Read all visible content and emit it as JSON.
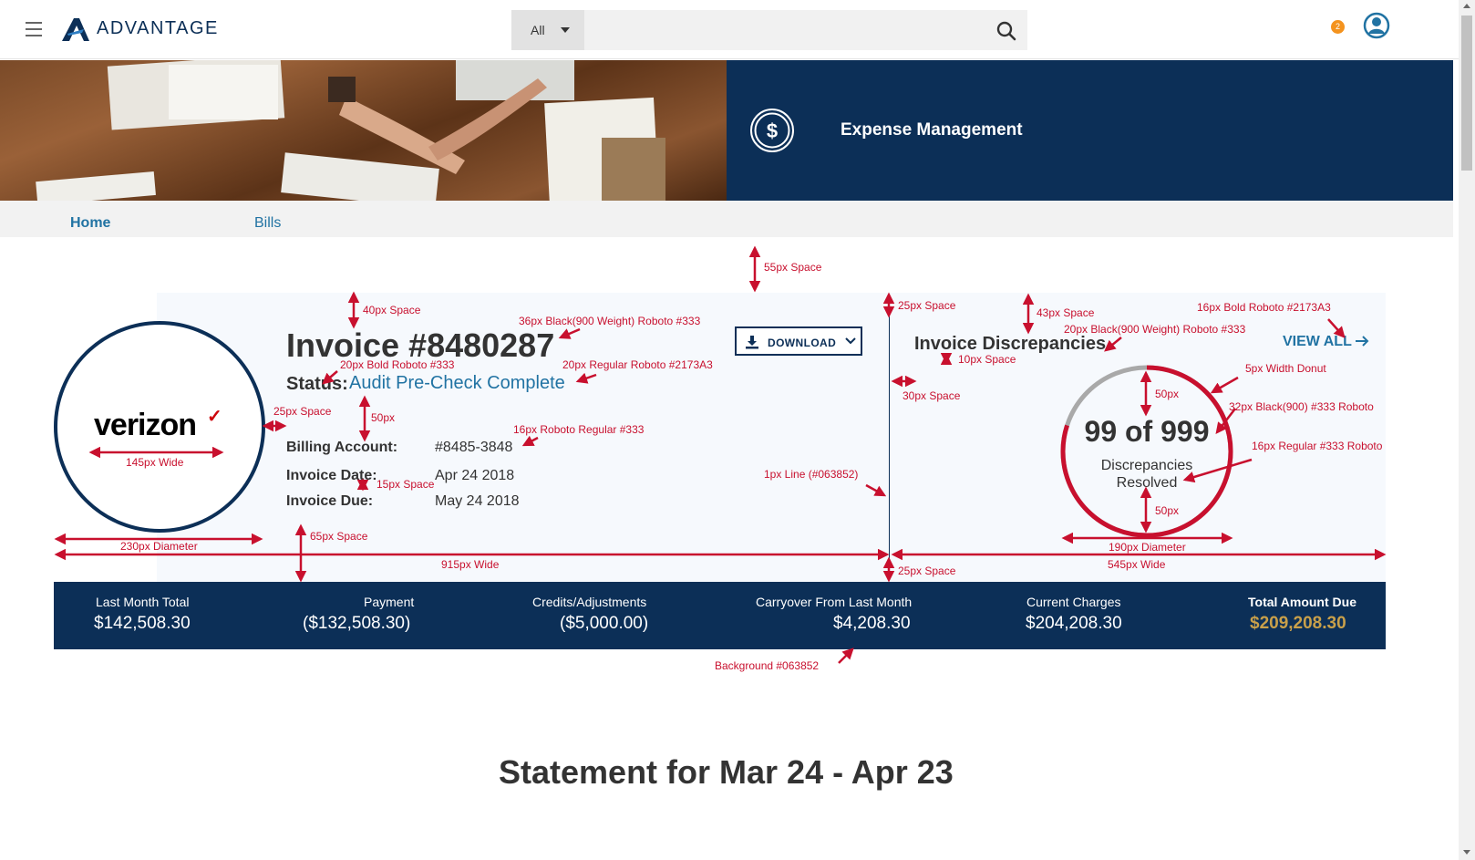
{
  "header": {
    "logo_text": "ADVANTAGE",
    "search_filter": "All",
    "search_placeholder": "",
    "notification_count": "2"
  },
  "banner": {
    "title": "Expense Management"
  },
  "tabs": [
    {
      "label": "Home"
    },
    {
      "label": "Bills"
    }
  ],
  "invoice": {
    "carrier": "verizon",
    "carrier_mark": "✓",
    "title": "Invoice #8480287",
    "status_label": "Status:",
    "status_value": "Audit Pre-Check Complete",
    "fields": [
      {
        "label": "Billing Account:",
        "value": "#8485-3848"
      },
      {
        "label": "Invoice Date:",
        "value": "Apr 24 2018"
      },
      {
        "label": "Invoice Due:",
        "value": "May 24 2018"
      }
    ],
    "download_label": "DOWNLOAD"
  },
  "discrepancies": {
    "title": "Invoice Discrepancies",
    "view_all_label": "VIEW ALL",
    "value": "99 of 999",
    "caption_line1": "Discrepancies",
    "caption_line2": "Resolved",
    "resolved": 99,
    "total": 999
  },
  "totals": [
    {
      "label": "Last Month Total",
      "value": "$142,508.30"
    },
    {
      "label": "Payment",
      "value": "($132,508.30)"
    },
    {
      "label": "Credits/Adjustments",
      "value": "($5,000.00)"
    },
    {
      "label": "Carryover From Last Month",
      "value": "$4,208.30"
    },
    {
      "label": "Current Charges",
      "value": "$204,208.30"
    },
    {
      "label": "Total Amount Due",
      "value": "$209,208.30"
    }
  ],
  "statement_title": "Statement for Mar 24 - Apr 23",
  "annotations": [
    "55px Space",
    "40px Space",
    "36px Black(900 Weight) Roboto #333",
    "20px Bold Roboto #333",
    "20px Regular Roboto #2173A3",
    "25px Space",
    "50px",
    "16px Roboto Regular #333",
    "145px Wide",
    "15px Space",
    "230px Diameter",
    "65px Space",
    "915px Wide",
    "1px Line (#063852)",
    "25px Space",
    "43px Space",
    "16px Bold Roboto #2173A3",
    "20px Black(900 Weight) Roboto #333",
    "10px Space",
    "30px Space",
    "5px Width Donut",
    "50px",
    "32px Black(900) #333 Roboto",
    "16px Regular #333 Roboto",
    "50px",
    "190px Diameter",
    "545px Wide",
    "25px Space",
    "Background #063852"
  ],
  "colors": {
    "navy": "#0c2f57",
    "link": "#2173a3",
    "text": "#333333",
    "gold": "#c9a04a",
    "red": "#c8102e",
    "badge": "#f4931e"
  }
}
